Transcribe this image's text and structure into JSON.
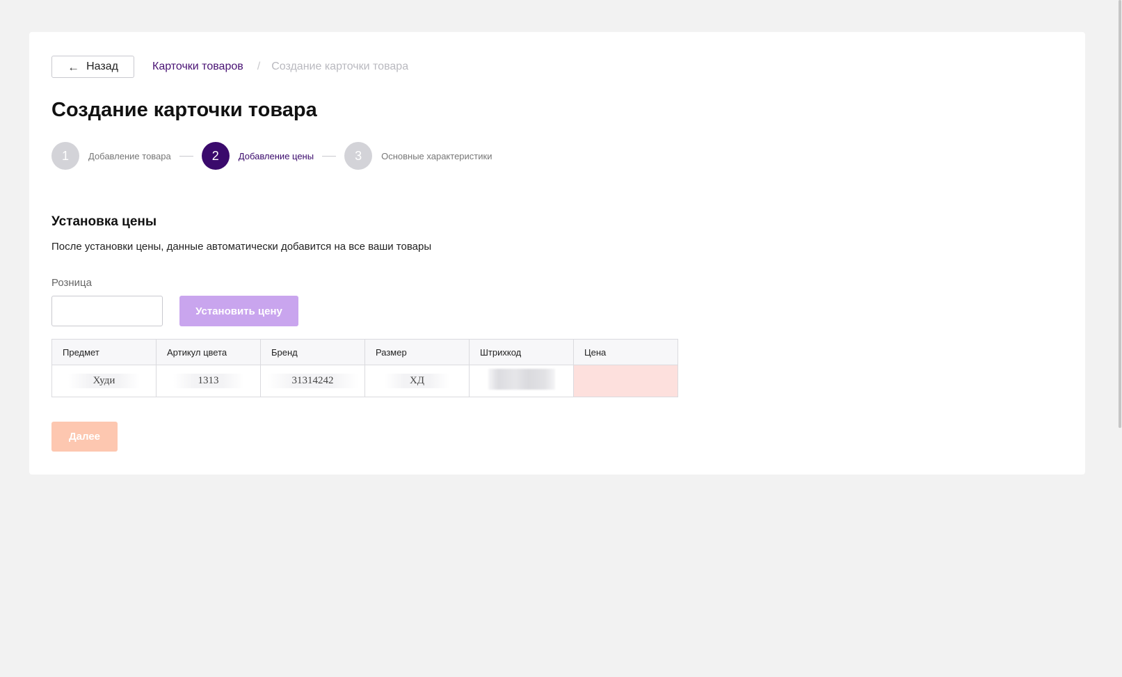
{
  "header": {
    "back_label": "Назад",
    "back_icon": "arrow-left-icon",
    "breadcrumb": {
      "link": "Карточки товаров",
      "separator": "/",
      "current": "Создание карточки товара"
    }
  },
  "page_title": "Создание карточки товара",
  "stepper": {
    "steps": [
      {
        "number": "1",
        "label": "Добавление товара",
        "state": "inactive"
      },
      {
        "number": "2",
        "label": "Добавление цены",
        "state": "active"
      },
      {
        "number": "3",
        "label": "Основные характеристики",
        "state": "inactive"
      }
    ]
  },
  "price_section": {
    "title": "Установка цены",
    "description": "После установки цены, данные автоматически добавится на все ваши товары",
    "field_label": "Розница",
    "input_value": "",
    "input_placeholder": "",
    "set_button_label": "Установить цену"
  },
  "table": {
    "columns": [
      "Предмет",
      "Артикул цвета",
      "Бренд",
      "Размер",
      "Штрихкод",
      "Цена"
    ],
    "rows": [
      {
        "subject": "Худи",
        "color_article": "1313",
        "brand": "31314242",
        "size": "ХД",
        "barcode": "",
        "price": ""
      }
    ]
  },
  "footer": {
    "next_label": "Далее"
  },
  "colors": {
    "accent": "#3a0a6c",
    "link": "#481173",
    "set_button_disabled": "#c9a5ee",
    "next_button_disabled": "#fdc7b0",
    "price_cell_error": "#fde0dd"
  }
}
